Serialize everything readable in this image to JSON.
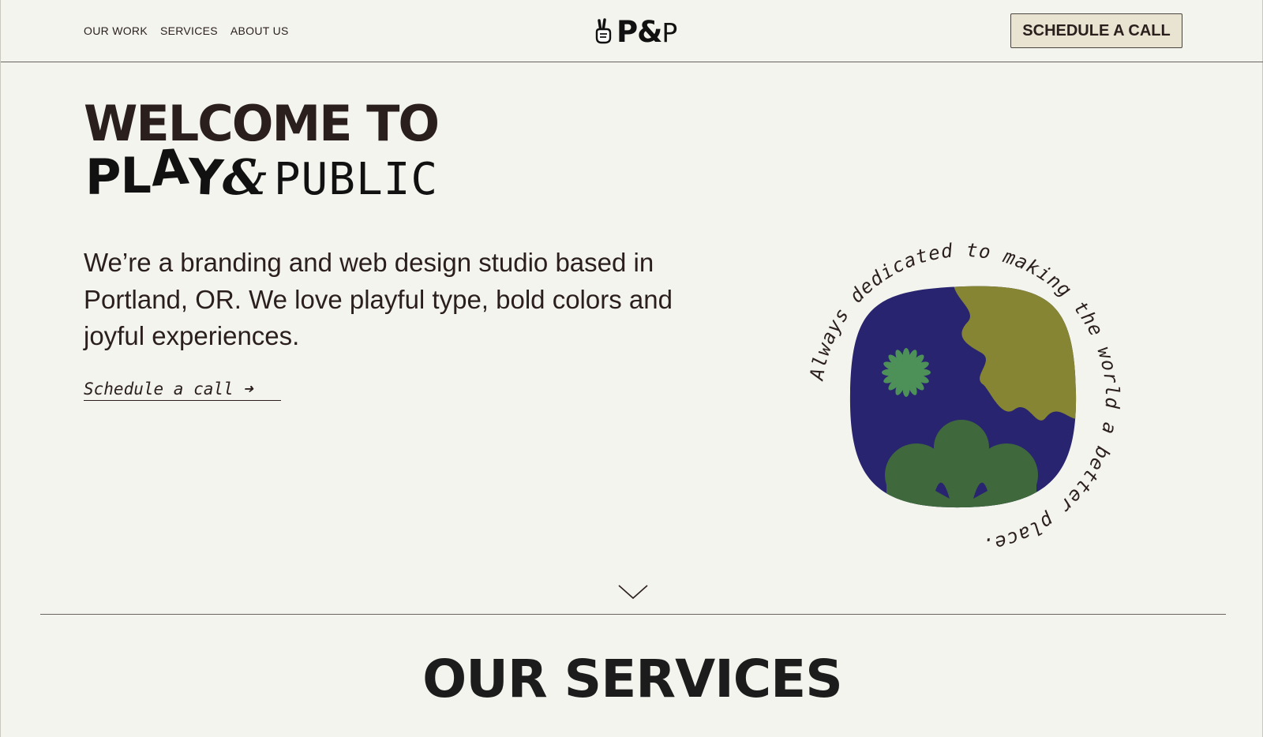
{
  "nav": {
    "items": [
      {
        "label": "OUR WORK"
      },
      {
        "label": "SERVICES"
      },
      {
        "label": "ABOUT US"
      }
    ]
  },
  "logo": {
    "brand_bold": "P&",
    "brand_light": "P"
  },
  "header": {
    "cta_label": "SCHEDULE A CALL"
  },
  "hero": {
    "title_line1": "WELCOME TO",
    "play_text": {
      "p": "P",
      "l": "L",
      "a": "A",
      "y": "Y",
      "amp": "&"
    },
    "public_text": "PUBLIC",
    "intro": "We’re a branding and web design studio based in Portland, OR. We love playful type, bold colors and joyful experiences.",
    "schedule_link": "Schedule a call",
    "schedule_arrow": "➜"
  },
  "badge": {
    "circular_text": "Always dedicated to making the world a better place. ",
    "colors": {
      "navy": "#28246f",
      "olive": "#858533",
      "green": "#3f683d",
      "flower": "#4d9058"
    }
  },
  "services": {
    "title": "OUR SERVICES"
  }
}
